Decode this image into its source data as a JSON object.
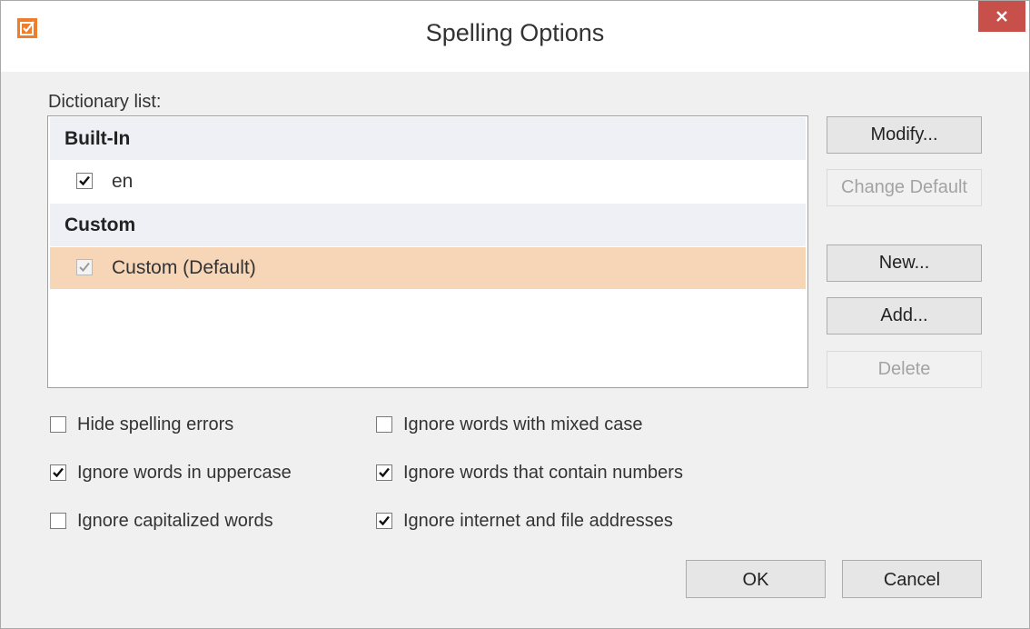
{
  "window": {
    "title": "Spelling Options"
  },
  "icons": {
    "app": "checkbox-edit-icon",
    "close": "close-icon",
    "check": "checkmark-icon"
  },
  "colors": {
    "close_bg": "#c7504a",
    "selected_row": "#f7d5b7",
    "app_icon": "#f07d2a",
    "group_bg": "#eef0f5"
  },
  "dictionary": {
    "label": "Dictionary list:",
    "groups": [
      {
        "header": "Built-In",
        "items": [
          {
            "label": "en",
            "checked": true,
            "disabled": false,
            "selected": false
          }
        ]
      },
      {
        "header": "Custom",
        "items": [
          {
            "label": "Custom (Default)",
            "checked": true,
            "disabled": true,
            "selected": true
          }
        ]
      }
    ]
  },
  "side_buttons": {
    "modify": "Modify...",
    "change_default": "Change Default",
    "new": "New...",
    "add": "Add...",
    "delete": "Delete"
  },
  "options": {
    "hide_spelling_errors": {
      "label": "Hide spelling errors",
      "checked": false
    },
    "ignore_uppercase": {
      "label": "Ignore words in uppercase",
      "checked": true
    },
    "ignore_capitalized": {
      "label": "Ignore capitalized words",
      "checked": false
    },
    "ignore_mixed_case": {
      "label": "Ignore words with mixed case",
      "checked": false
    },
    "ignore_numbers": {
      "label": "Ignore words that contain numbers",
      "checked": true
    },
    "ignore_addresses": {
      "label": "Ignore internet and file addresses",
      "checked": true
    }
  },
  "footer": {
    "ok": "OK",
    "cancel": "Cancel"
  }
}
